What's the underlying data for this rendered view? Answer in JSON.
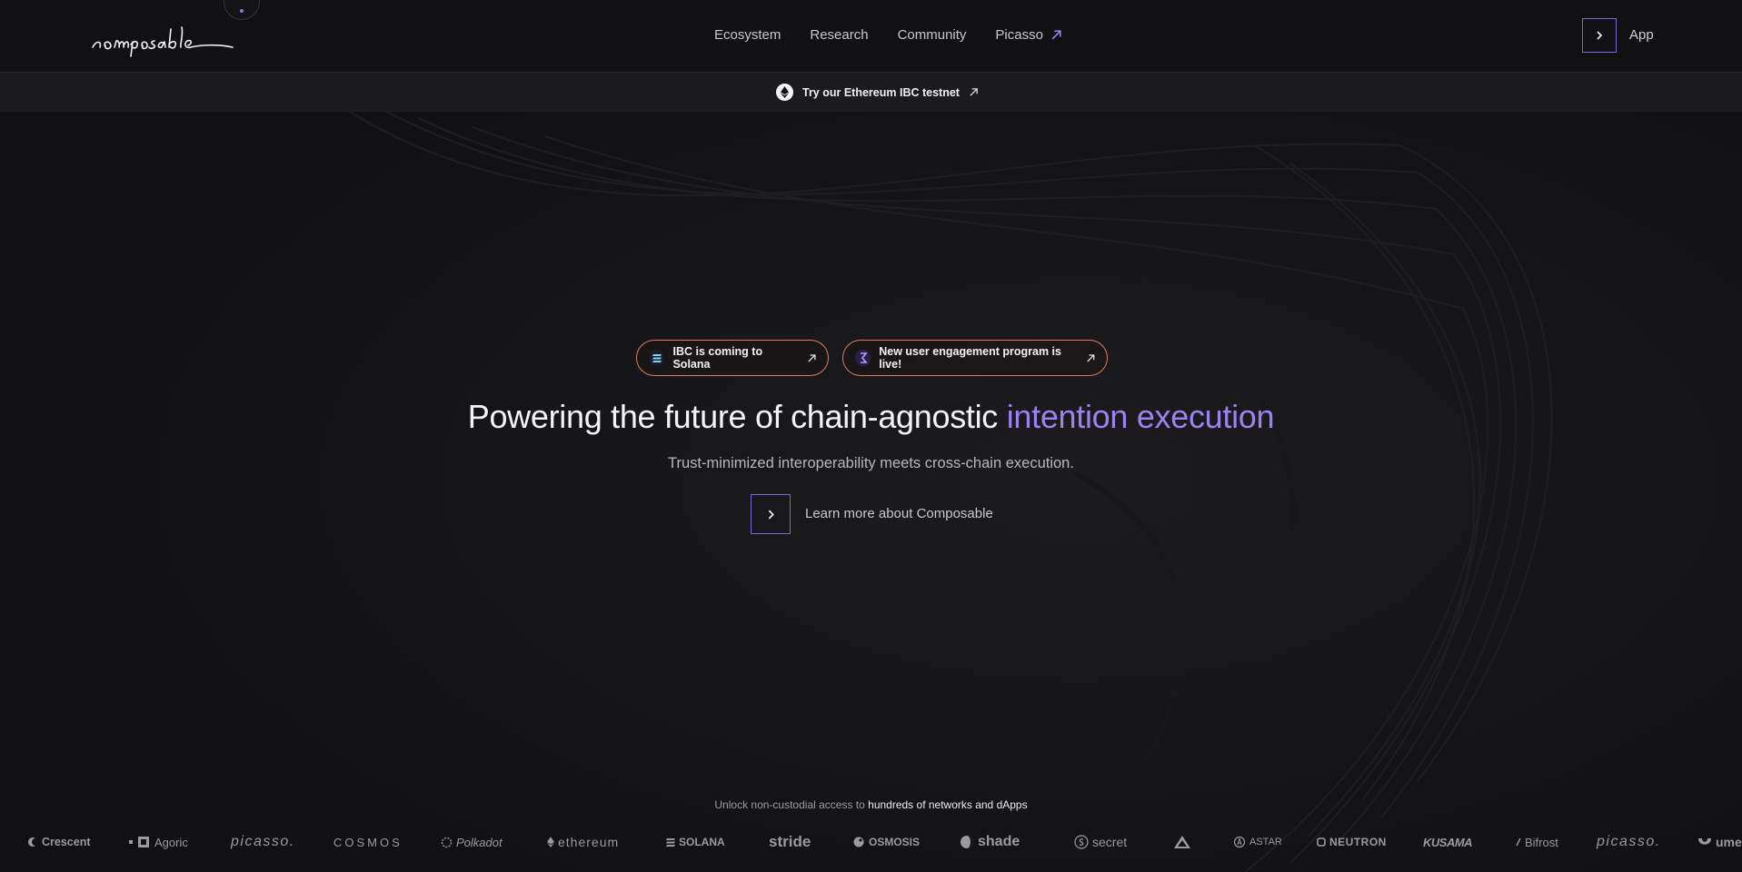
{
  "brand": {
    "logo_text": "composable",
    "accent_color": "#9b82f0",
    "border_accent": "#7b68d9",
    "pill_border": "#e07a5f"
  },
  "nav": {
    "items": [
      {
        "label": "Ecosystem"
      },
      {
        "label": "Research"
      },
      {
        "label": "Community"
      },
      {
        "label": "Picasso",
        "external": true
      }
    ],
    "app_label": "App"
  },
  "banner": {
    "text": "Try our Ethereum IBC testnet",
    "icon": "ethereum-icon"
  },
  "pills": [
    {
      "text": "IBC is coming to Solana",
      "icon": "solana-icon"
    },
    {
      "text": "New user engagement program is live!",
      "icon": "program-icon"
    }
  ],
  "hero": {
    "title_main": "Powering the future of chain-agnostic ",
    "title_accent": "intention execution",
    "subtitle": "Trust-minimized interoperability meets cross-chain execution.",
    "cta_label": "Learn more about Composable"
  },
  "partners": {
    "intro": "Unlock non-custodial access to ",
    "intro_bold": "hundreds of networks and dApps",
    "logos": [
      "Crescent",
      "Agoric",
      "picasso.",
      "COSMOS",
      "Polkadot",
      "ethereum",
      "SOLANA",
      "stride",
      "OSMOSIS",
      "shade",
      "secret",
      "",
      "ASTAR",
      "NEUTRON",
      "KUSAMA",
      "Bifrost",
      "picasso.",
      "ume"
    ]
  }
}
